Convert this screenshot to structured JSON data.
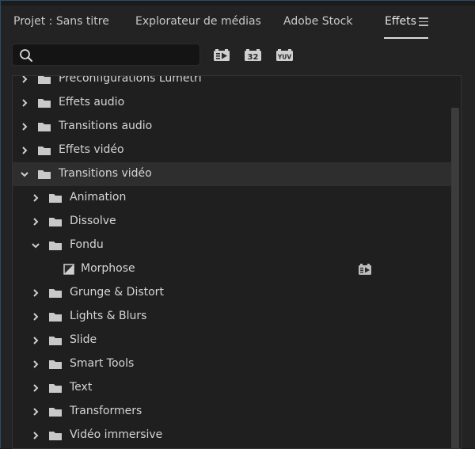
{
  "tabs": [
    {
      "label": "Projet : Sans titre",
      "active": false
    },
    {
      "label": "Explorateur de médias",
      "active": false
    },
    {
      "label": "Adobe Stock",
      "active": false
    },
    {
      "label": "Effets",
      "active": true
    }
  ],
  "search": {
    "value": "",
    "placeholder": ""
  },
  "toolbar": {
    "accelerated_icon": "accelerated-effect-icon",
    "bit32_label": "32",
    "yuv_label": "YUV"
  },
  "tree": [
    {
      "label": "Préconfigurations Lumetri",
      "level": 0,
      "expanded": false,
      "kind": "folder"
    },
    {
      "label": "Effets audio",
      "level": 0,
      "expanded": false,
      "kind": "folder"
    },
    {
      "label": "Transitions audio",
      "level": 0,
      "expanded": false,
      "kind": "folder"
    },
    {
      "label": "Effets vidéo",
      "level": 0,
      "expanded": false,
      "kind": "folder"
    },
    {
      "label": "Transitions vidéo",
      "level": 0,
      "expanded": true,
      "kind": "folder",
      "selected": true
    },
    {
      "label": "Animation",
      "level": 1,
      "expanded": false,
      "kind": "folder"
    },
    {
      "label": "Dissolve",
      "level": 1,
      "expanded": false,
      "kind": "folder"
    },
    {
      "label": "Fondu",
      "level": 1,
      "expanded": true,
      "kind": "folder"
    },
    {
      "label": "Morphose",
      "level": 2,
      "kind": "effect",
      "accelerated": true
    },
    {
      "label": "Grunge & Distort",
      "level": 1,
      "expanded": false,
      "kind": "folder"
    },
    {
      "label": "Lights & Blurs",
      "level": 1,
      "expanded": false,
      "kind": "folder"
    },
    {
      "label": "Slide",
      "level": 1,
      "expanded": false,
      "kind": "folder"
    },
    {
      "label": "Smart Tools",
      "level": 1,
      "expanded": false,
      "kind": "folder"
    },
    {
      "label": "Text",
      "level": 1,
      "expanded": false,
      "kind": "folder"
    },
    {
      "label": "Transformers",
      "level": 1,
      "expanded": false,
      "kind": "folder"
    },
    {
      "label": "Vidéo immersive",
      "level": 1,
      "expanded": false,
      "kind": "folder"
    }
  ],
  "colors": {
    "panel_bg": "#232323",
    "selected_row": "#2e2e2e",
    "text": "#d4d4d4"
  }
}
